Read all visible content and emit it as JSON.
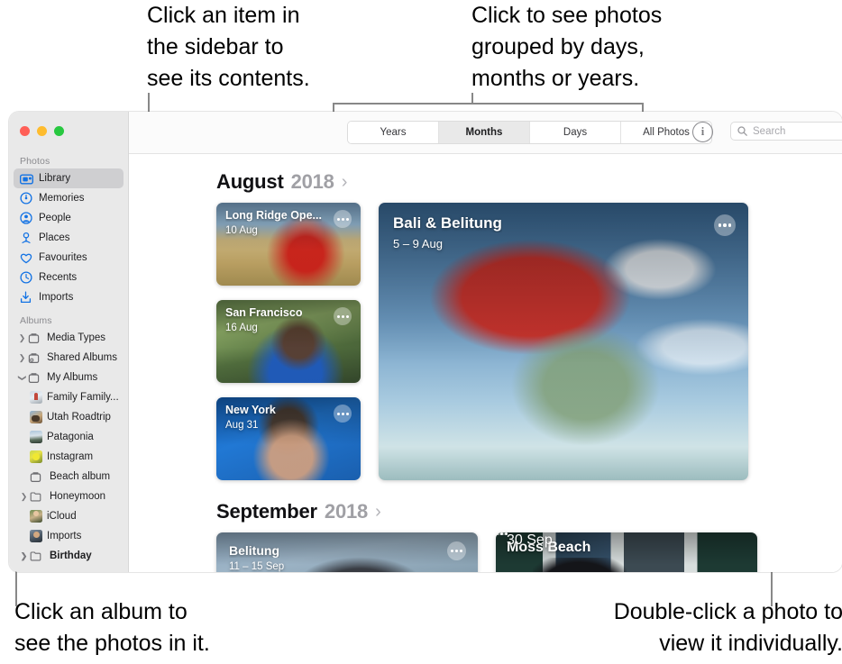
{
  "callouts": {
    "top_left": "Click an item in\nthe sidebar to\nsee its contents.",
    "top_right": "Click to see photos\ngrouped by days,\nmonths or years.",
    "bottom_left": "Click an album to\nsee the photos in it.",
    "bottom_right": "Double-click a photo to\nview it individually."
  },
  "window": {
    "traffic_lights": {
      "close": "close-button",
      "minimize": "minimize-button",
      "zoom": "zoom-button"
    }
  },
  "sidebar": {
    "sections": [
      {
        "title": "Photos",
        "items": [
          {
            "label": "Library",
            "icon": "library-icon",
            "selected": true,
            "disclosure": "none"
          },
          {
            "label": "Memories",
            "icon": "memories-icon",
            "selected": false,
            "disclosure": "none"
          },
          {
            "label": "People",
            "icon": "people-icon",
            "selected": false,
            "disclosure": "none"
          },
          {
            "label": "Places",
            "icon": "places-icon",
            "selected": false,
            "disclosure": "none"
          },
          {
            "label": "Favourites",
            "icon": "heart-icon",
            "selected": false,
            "disclosure": "none"
          },
          {
            "label": "Recents",
            "icon": "clock-icon",
            "selected": false,
            "disclosure": "none"
          },
          {
            "label": "Imports",
            "icon": "import-icon",
            "selected": false,
            "disclosure": "none"
          }
        ]
      },
      {
        "title": "Albums",
        "items": [
          {
            "label": "Media Types",
            "icon": "folder-icon",
            "disclosure": "collapsed"
          },
          {
            "label": "Shared Albums",
            "icon": "shared-album-icon",
            "disclosure": "collapsed"
          },
          {
            "label": "My Albums",
            "icon": "folder-icon",
            "disclosure": "expanded"
          },
          {
            "label": "Family Family...",
            "icon": "album-thumb-family",
            "disclosure": "none",
            "sub": true
          },
          {
            "label": "Utah Roadtrip",
            "icon": "album-thumb-utah",
            "disclosure": "none",
            "sub": true
          },
          {
            "label": "Patagonia",
            "icon": "album-thumb-patagonia",
            "disclosure": "none",
            "sub": true
          },
          {
            "label": "Instagram",
            "icon": "album-thumb-instagram",
            "disclosure": "none",
            "sub": true
          },
          {
            "label": "Beach album",
            "icon": "album-icon",
            "disclosure": "none",
            "sub": true
          },
          {
            "label": "Honeymoon",
            "icon": "folder-outline-icon",
            "disclosure": "collapsed",
            "sub": true
          },
          {
            "label": "iCloud",
            "icon": "album-thumb-icloud",
            "disclosure": "none",
            "sub": true
          },
          {
            "label": "Imports",
            "icon": "album-thumb-imports",
            "disclosure": "none",
            "sub": true
          },
          {
            "label": "Birthday",
            "icon": "folder-outline-icon",
            "disclosure": "collapsed",
            "sub": true,
            "bold": true
          }
        ]
      }
    ]
  },
  "toolbar": {
    "segments": [
      {
        "label": "Years",
        "active": false
      },
      {
        "label": "Months",
        "active": true
      },
      {
        "label": "Days",
        "active": false
      },
      {
        "label": "All Photos",
        "active": false
      }
    ],
    "info_label": "i",
    "search_placeholder": "Search",
    "search_value": ""
  },
  "content": {
    "groups": [
      {
        "month": "August",
        "year": "2018",
        "arrow": "›",
        "small_cards": [
          {
            "title": "Long Ridge Ope...",
            "date": "10 Aug",
            "photo": "ph-longridge"
          },
          {
            "title": "San Francisco",
            "date": "16 Aug",
            "photo": "ph-sf"
          },
          {
            "title": "New York",
            "date": "Aug 31",
            "photo": "ph-ny"
          }
        ],
        "large_card": {
          "title": "Bali & Belitung",
          "date": "5 – 9 Aug",
          "photo": "ph-bali"
        }
      },
      {
        "month": "September",
        "year": "2018",
        "arrow": "›",
        "wide_cards": [
          {
            "title": "Belitung",
            "date": "11 – 15 Sep",
            "photo": "ph-belitung"
          },
          {
            "title": "Moss Beach",
            "date": "30 Sep",
            "photo": "ph-mossbeach"
          }
        ]
      }
    ]
  },
  "colors": {
    "accent_blue": "#1272e4",
    "sidebar_bg": "#e9e9e9",
    "sidebar_selected": "#cfcfd1",
    "toolbar_bg": "#fbfbfb",
    "leader_line": "#888888",
    "month_year_grey": "#a0a0a5"
  }
}
